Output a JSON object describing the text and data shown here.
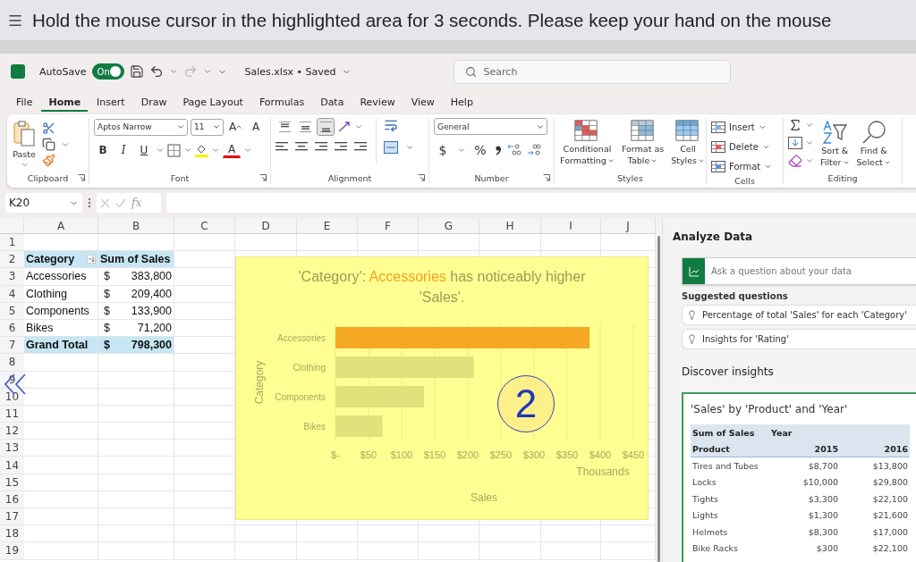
{
  "instruction": {
    "text": "Hold the mouse cursor in the highlighted area for 3 seconds. Please keep your hand on the mouse"
  },
  "title_bar": {
    "autosave_label": "AutoSave",
    "autosave": {
      "on": true,
      "label": "On"
    },
    "file_title": "Sales.xlsx • Saved",
    "search": {
      "placeholder": "Search"
    }
  },
  "menu_tabs": [
    {
      "label": "File",
      "selected": false
    },
    {
      "label": "Home",
      "selected": true
    },
    {
      "label": "Insert",
      "selected": false
    },
    {
      "label": "Draw",
      "selected": false
    },
    {
      "label": "Page Layout",
      "selected": false
    },
    {
      "label": "Formulas",
      "selected": false
    },
    {
      "label": "Data",
      "selected": false
    },
    {
      "label": "Review",
      "selected": false
    },
    {
      "label": "View",
      "selected": false
    },
    {
      "label": "Help",
      "selected": false
    }
  ],
  "ribbon": {
    "groups": [
      {
        "kind": "clipboard",
        "label": "Clipboard",
        "paste": "Paste"
      },
      {
        "kind": "font",
        "label": "Font",
        "font_name": "Aptos Narrow",
        "font_size": "11",
        "grow": "A",
        "shrink": "A",
        "bold": "B",
        "italic": "I",
        "underline": "U",
        "font_color": "A"
      },
      {
        "kind": "alignment",
        "label": "Alignment",
        "vertical_align": [
          {
            "selected": false
          },
          {
            "selected": false
          },
          {
            "selected": true
          }
        ]
      },
      {
        "kind": "number",
        "label": "Number",
        "format": "General",
        "currency": "$",
        "percent": "%"
      },
      {
        "kind": "styles",
        "label": "Styles",
        "buttons": [
          {
            "lines": [
              "Conditional",
              "Formatting"
            ]
          },
          {
            "lines": [
              "Format as",
              "Table"
            ]
          },
          {
            "lines": [
              "Cell",
              "Styles"
            ]
          }
        ]
      },
      {
        "kind": "cells",
        "label": "Cells",
        "buttons": [
          "Insert",
          "Delete",
          "Format"
        ]
      },
      {
        "kind": "editing",
        "label": "Editing",
        "buttons": [
          {
            "lines": [
              "Sort &",
              "Filter"
            ]
          },
          {
            "lines": [
              "Find &",
              "Select"
            ]
          }
        ]
      }
    ]
  },
  "formula_bar": {
    "name_box": "K20",
    "function_label": "fx"
  },
  "sheet": {
    "columns": [
      "A",
      "B",
      "C",
      "D",
      "E",
      "F",
      "G",
      "H",
      "I",
      "J"
    ],
    "row_numbers": [
      "1",
      "2",
      "3",
      "4",
      "5",
      "6",
      "7",
      "8",
      "9",
      "10",
      "11",
      "12",
      "13",
      "14",
      "15",
      "16",
      "17",
      "18",
      "19"
    ],
    "pivot": {
      "headers": [
        "Category",
        "Sum of Sales"
      ],
      "rows": [
        {
          "category": "Accessories",
          "currency": "$",
          "amount": "383,800"
        },
        {
          "category": "Clothing",
          "currency": "$",
          "amount": "209,400"
        },
        {
          "category": "Components",
          "currency": "$",
          "amount": "133,900"
        },
        {
          "category": "Bikes",
          "currency": "$",
          "amount": "71,200"
        }
      ],
      "total": {
        "category": "Grand Total",
        "currency": "$",
        "amount": "798,300"
      }
    },
    "chart": {
      "title_parts": [
        {
          "text": "'Category': ",
          "highlight": false
        },
        {
          "text": "Accessories",
          "highlight": true
        },
        {
          "text": " has noticeably higher 'Sales'.",
          "highlight": false
        }
      ],
      "units_label": "Thousands",
      "callout": "2",
      "chart_data": {
        "type": "bar",
        "orientation": "horizontal",
        "xlabel": "Sales",
        "ylabel": "Category",
        "categories": [
          "Accessories",
          "Clothing",
          "Components",
          "Bikes"
        ],
        "series": [
          {
            "color": "#f4a823",
            "values": [
              384,
              null,
              null,
              null
            ]
          },
          {
            "color": "#e2e27c",
            "values": [
              null,
              209,
              134,
              71
            ]
          }
        ],
        "stacked": true,
        "grid": true,
        "xlim": [
          0,
          450
        ],
        "xticks": [
          {
            "value": 0,
            "label": "$-"
          },
          {
            "value": 50,
            "label": "$50"
          },
          {
            "value": 100,
            "label": "$100"
          },
          {
            "value": 150,
            "label": "$150"
          },
          {
            "value": 200,
            "label": "$200"
          },
          {
            "value": 250,
            "label": "$250"
          },
          {
            "value": 300,
            "label": "$300"
          },
          {
            "value": 350,
            "label": "$350"
          },
          {
            "value": 400,
            "label": "$400"
          },
          {
            "value": 450,
            "label": "$450"
          }
        ]
      }
    }
  },
  "analyze_pane": {
    "title": "Analyze Data",
    "ask": {
      "placeholder": "Ask a question about your data"
    },
    "suggested_heading": "Suggested questions",
    "suggestions": [
      "Percentage of total 'Sales' for each 'Category'",
      "Insights for 'Rating'"
    ],
    "discover_heading": "Discover insights",
    "insight": {
      "title": "'Sales' by 'Product' and 'Year'",
      "values_label": "Sum of Sales",
      "column_field": "Year",
      "row_field": "Product",
      "years": [
        "2015",
        "2016"
      ],
      "rows": [
        {
          "product": "Tires and Tubes",
          "values": [
            "$8,700",
            "$13,800"
          ]
        },
        {
          "product": "Locks",
          "values": [
            "$10,000",
            "$29,800"
          ]
        },
        {
          "product": "Tights",
          "values": [
            "$3,300",
            "$22,100"
          ]
        },
        {
          "product": "Lights",
          "values": [
            "$1,300",
            "$21,600"
          ]
        },
        {
          "product": "Helmets",
          "values": [
            "$8,300",
            "$17,000"
          ]
        },
        {
          "product": "Bike Racks",
          "values": [
            "$300",
            "$22,100"
          ]
        }
      ]
    }
  }
}
